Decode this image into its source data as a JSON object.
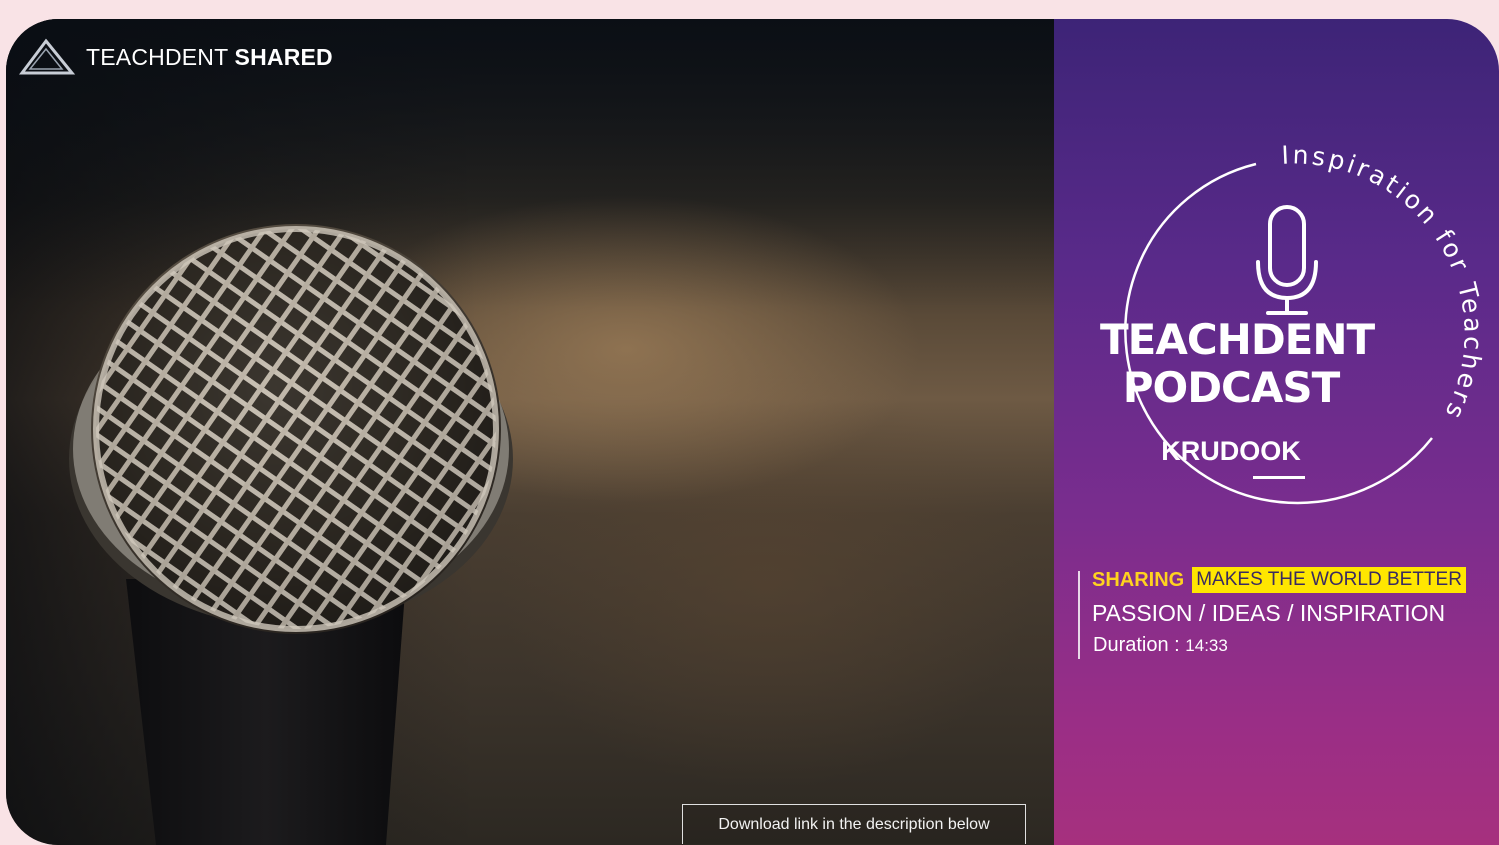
{
  "brand": {
    "name_light": "TEACHDENT",
    "name_bold": "SHARED",
    "icon": "triangle-logo-icon"
  },
  "cover": {
    "download_label": "Download link in the description below"
  },
  "podcast": {
    "arc_text": "Inspiration for Teachers",
    "title_line1": "TEACHDENT",
    "title_line2": "PODCAST",
    "host": "KRUDOOK",
    "icon": "microphone-icon"
  },
  "info": {
    "tag_prefix": "SHARING",
    "tag_highlight": "MAKES THE WORLD BETTER",
    "topics": "PASSION / IDEAS / INSPIRATION",
    "duration_label": "Duration :",
    "duration_value": "14:33"
  },
  "colors": {
    "page_bg": "#f9e3e6",
    "panel_top": "#3d2477",
    "panel_bottom": "#a6307e",
    "accent_yellow": "#ffe600"
  }
}
